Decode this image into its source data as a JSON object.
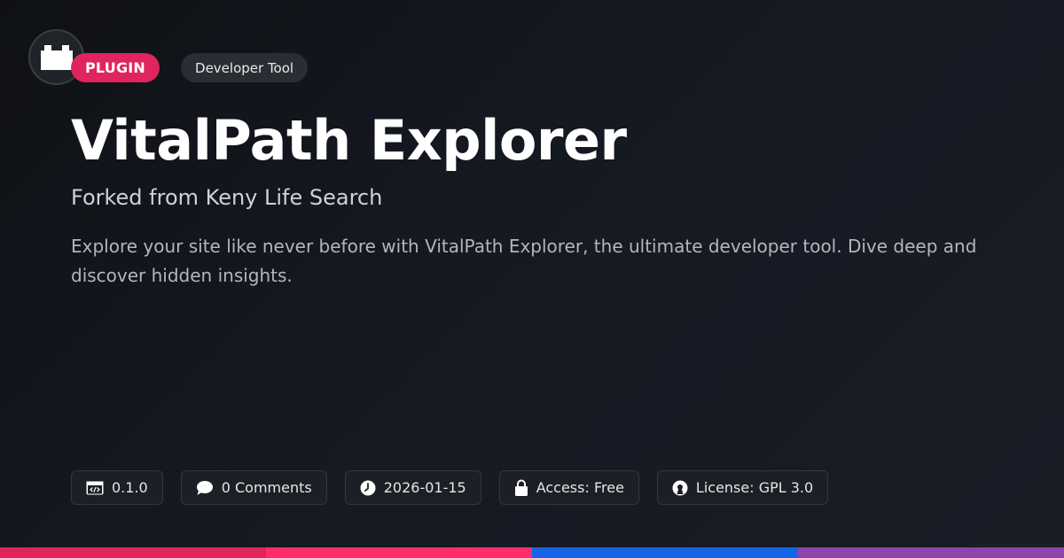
{
  "header": {
    "logo_icon": "plugin-block-icon",
    "type_badge": "PLUGIN",
    "category_badge": "Developer Tool"
  },
  "main": {
    "title": "VitalPath Explorer",
    "subtitle": "Forked from Keny Life Search",
    "description": "Explore your site like never before with VitalPath Explorer, the ultimate developer tool. Dive deep and discover hidden insights."
  },
  "meta": {
    "version": "0.1.0",
    "comments": "0 Comments",
    "date": "2026-01-15",
    "access": "Access: Free",
    "license": "License: GPL 3.0"
  },
  "colors": {
    "accent": "#e0245e",
    "bar": [
      "#e0245e",
      "#ff2d6b",
      "#1565e8",
      "#8e44ad"
    ]
  }
}
